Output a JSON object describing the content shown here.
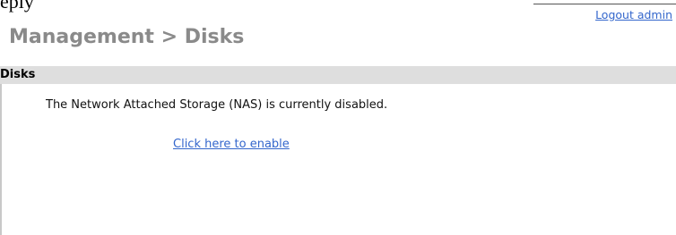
{
  "top_cut_text": "eply",
  "header": {
    "logout_label": "Logout admin"
  },
  "page": {
    "title": "Management > Disks"
  },
  "section": {
    "title": "Disks",
    "status_message": "The Network Attached Storage (NAS) is currently disabled.",
    "enable_link_label": "Click here to enable"
  },
  "colors": {
    "link": "#3366cc",
    "title": "#8a8a8a",
    "section_header_bg": "#dedede"
  }
}
